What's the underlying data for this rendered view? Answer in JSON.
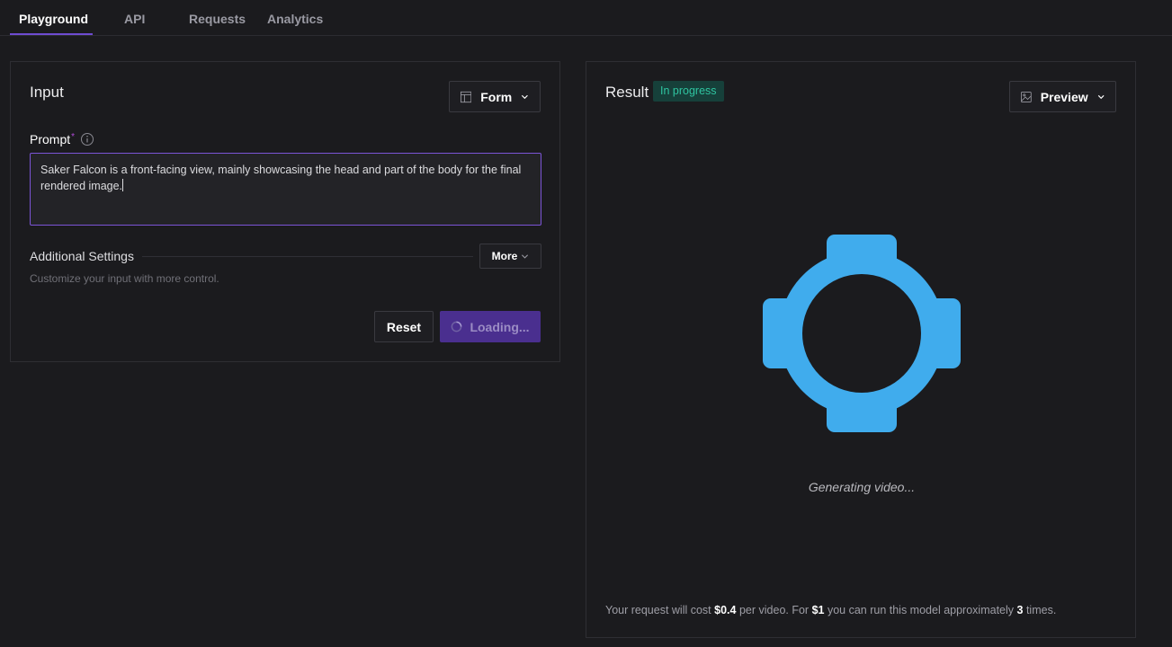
{
  "tabs": [
    {
      "label": "Playground",
      "active": true
    },
    {
      "label": "API",
      "active": false
    },
    {
      "label": "Requests",
      "active": false
    },
    {
      "label": "Analytics",
      "active": false
    }
  ],
  "input_panel": {
    "title": "Input",
    "view_select": {
      "label": "Form",
      "icon": "layout-icon"
    },
    "prompt": {
      "label": "Prompt",
      "required_marker": "*",
      "value": "Saker Falcon is a front-facing view, mainly showcasing the head and part of the body for the final rendered image."
    },
    "additional_settings": {
      "title": "Additional Settings",
      "more_label": "More",
      "hint": "Customize your input with more control."
    },
    "reset_label": "Reset",
    "submit_label": "Loading..."
  },
  "result_panel": {
    "title": "Result",
    "status_badge": "In progress",
    "view_select": {
      "label": "Preview",
      "icon": "image-icon"
    },
    "status_text": "Generating video...",
    "cost": {
      "prefix": "Your request will cost",
      "price": "$0.4",
      "mid1": "per video. For",
      "budget": "$1",
      "mid2": "you can run this model approximately",
      "runs": "3",
      "suffix": "times."
    }
  },
  "colors": {
    "accent": "#6e4bd1",
    "loading_button": "#4a2f8f",
    "badge_bg": "#16403a",
    "badge_text": "#2fc4a0",
    "placeholder_icon": "#40aced"
  }
}
